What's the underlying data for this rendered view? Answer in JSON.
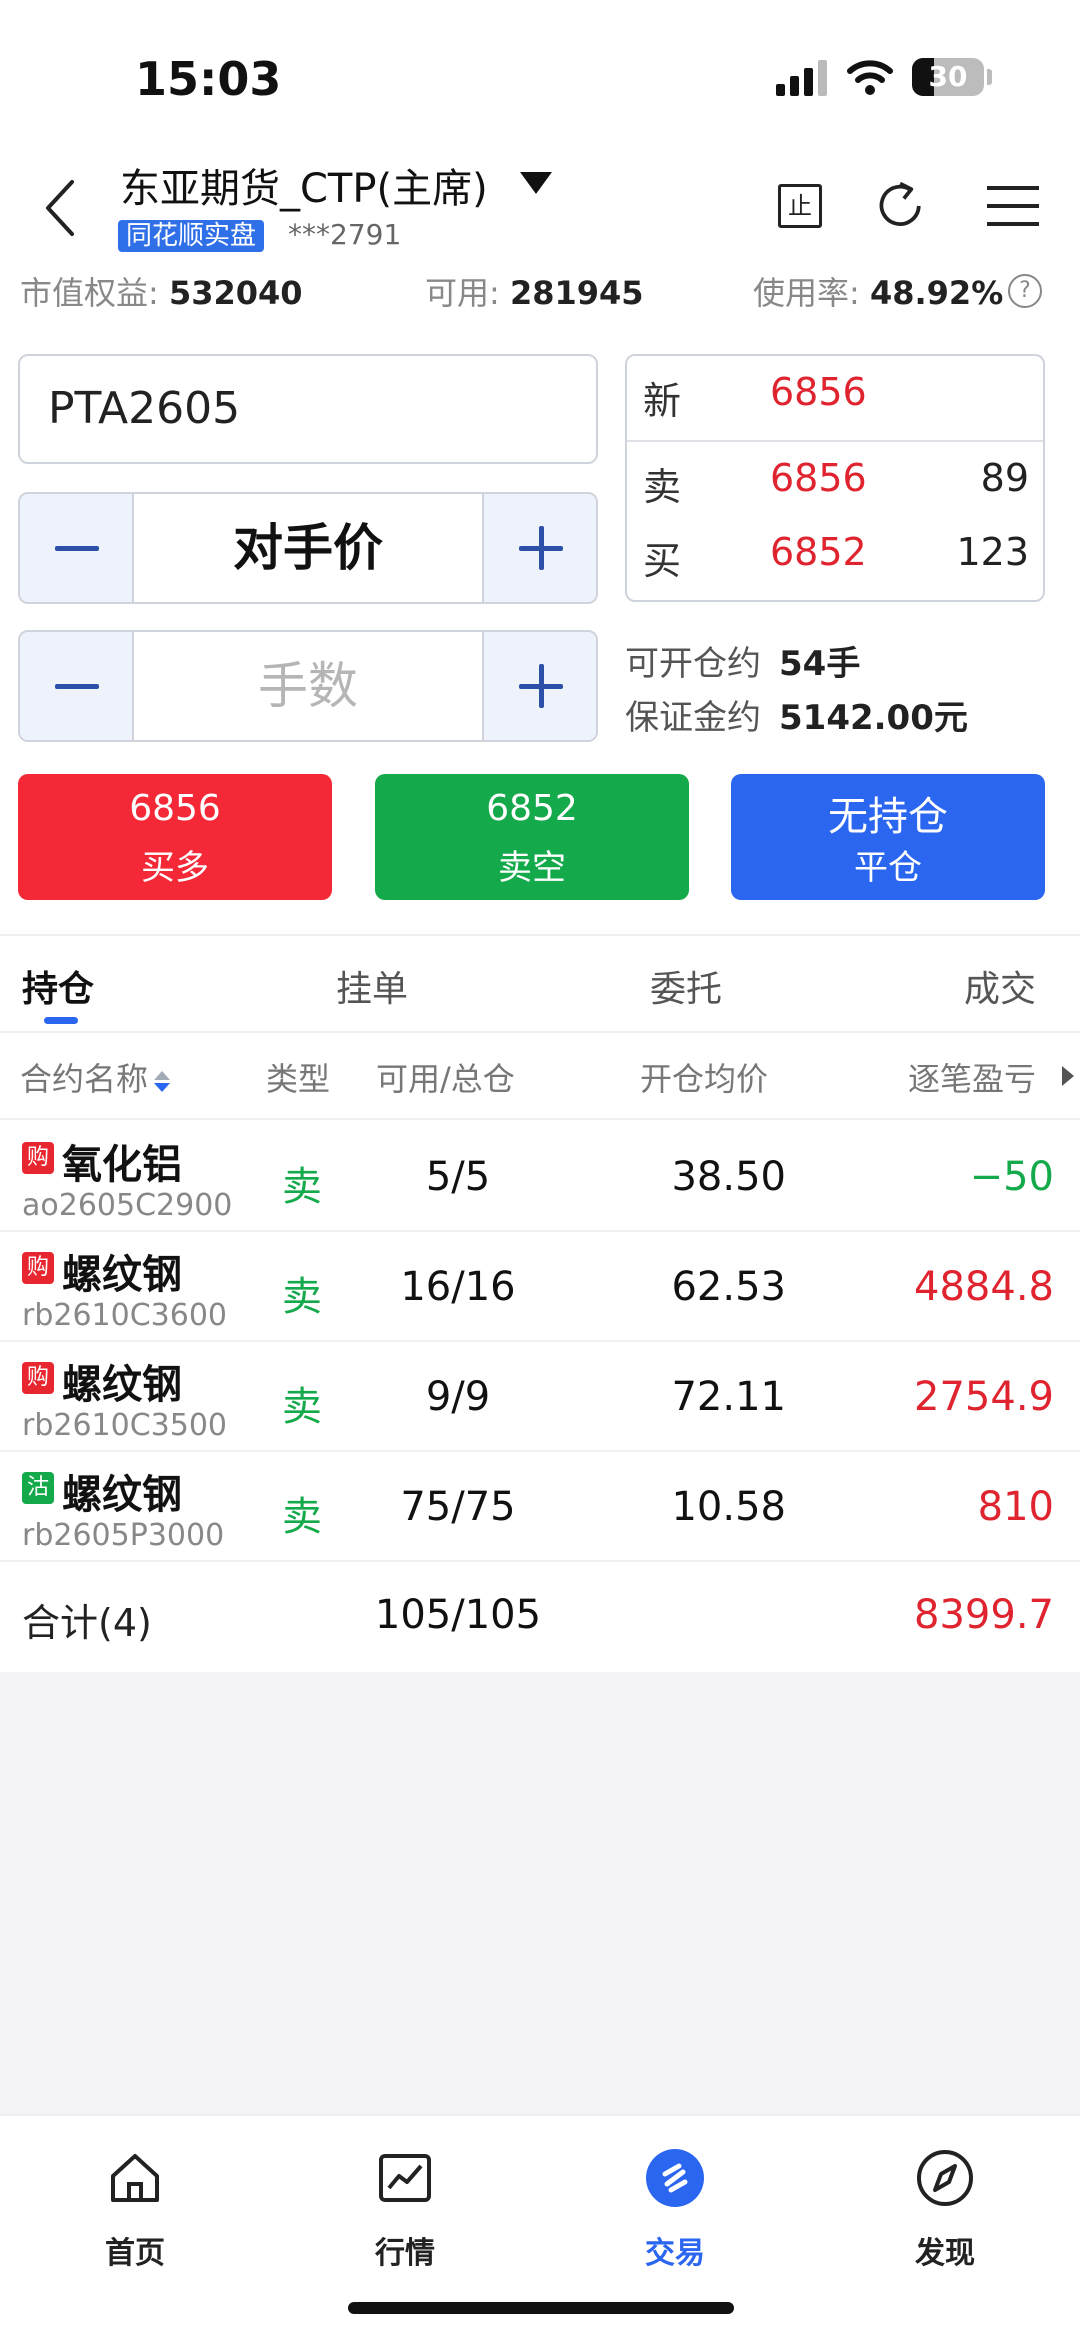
{
  "status_bar": {
    "time": "15:03",
    "battery": "30"
  },
  "header": {
    "account_title": "东亚期货_CTP(主席)",
    "account_badge": "同花顺实盘",
    "account_id": "***2791",
    "stop_icon_label": "止"
  },
  "summary": {
    "market_equity_label": "市值权益:",
    "market_equity_value": "532040",
    "available_label": "可用:",
    "available_value": "281945",
    "usage_label": "使用率:",
    "usage_value": "48.92%",
    "help_glyph": "?"
  },
  "order_form": {
    "contract_code": "PTA2605",
    "price_mode": "对手价",
    "lots_placeholder": "手数"
  },
  "quote": {
    "latest_label": "新",
    "latest_price": "6856",
    "ask_label": "卖",
    "ask_price": "6856",
    "ask_volume": "89",
    "bid_label": "买",
    "bid_price": "6852",
    "bid_volume": "123"
  },
  "info": {
    "openable_label": "可开仓约",
    "openable_value": "54手",
    "margin_label": "保证金约",
    "margin_value": "5142.00元"
  },
  "actions": {
    "buy_price": "6856",
    "buy_label": "买多",
    "sell_price": "6852",
    "sell_label": "卖空",
    "close_title": "无持仓",
    "close_label": "平仓"
  },
  "tabs": [
    "持仓",
    "挂单",
    "委托",
    "成交"
  ],
  "table": {
    "headers": [
      "合约名称",
      "类型",
      "可用/总仓",
      "开仓均价",
      "逐笔盈亏"
    ],
    "rows": [
      {
        "tag": "购",
        "name": "氧化铝",
        "code": "ao2605C2900",
        "type": "卖",
        "qty": "5/5",
        "avg": "38.50",
        "pnl": "−50"
      },
      {
        "tag": "购",
        "name": "螺纹钢",
        "code": "rb2610C3600",
        "type": "卖",
        "qty": "16/16",
        "avg": "62.53",
        "pnl": "4884.8"
      },
      {
        "tag": "购",
        "name": "螺纹钢",
        "code": "rb2610C3500",
        "type": "卖",
        "qty": "9/9",
        "avg": "72.11",
        "pnl": "2754.9"
      },
      {
        "tag": "沽",
        "name": "螺纹钢",
        "code": "rb2605P3000",
        "type": "卖",
        "qty": "75/75",
        "avg": "10.58",
        "pnl": "810"
      }
    ],
    "total_label": "合计(4)",
    "total_qty": "105/105",
    "total_pnl": "8399.7"
  },
  "bottom_nav": [
    "首页",
    "行情",
    "交易",
    "发现"
  ],
  "colors": {
    "up": "#e0242f",
    "down": "#14a94b",
    "accent": "#2b66f0"
  },
  "icons": [
    "back-icon",
    "dropdown-caret-icon",
    "stop-icon",
    "refresh-icon",
    "menu-icon",
    "help-icon",
    "home-icon",
    "market-icon",
    "trade-icon",
    "discover-icon"
  ]
}
